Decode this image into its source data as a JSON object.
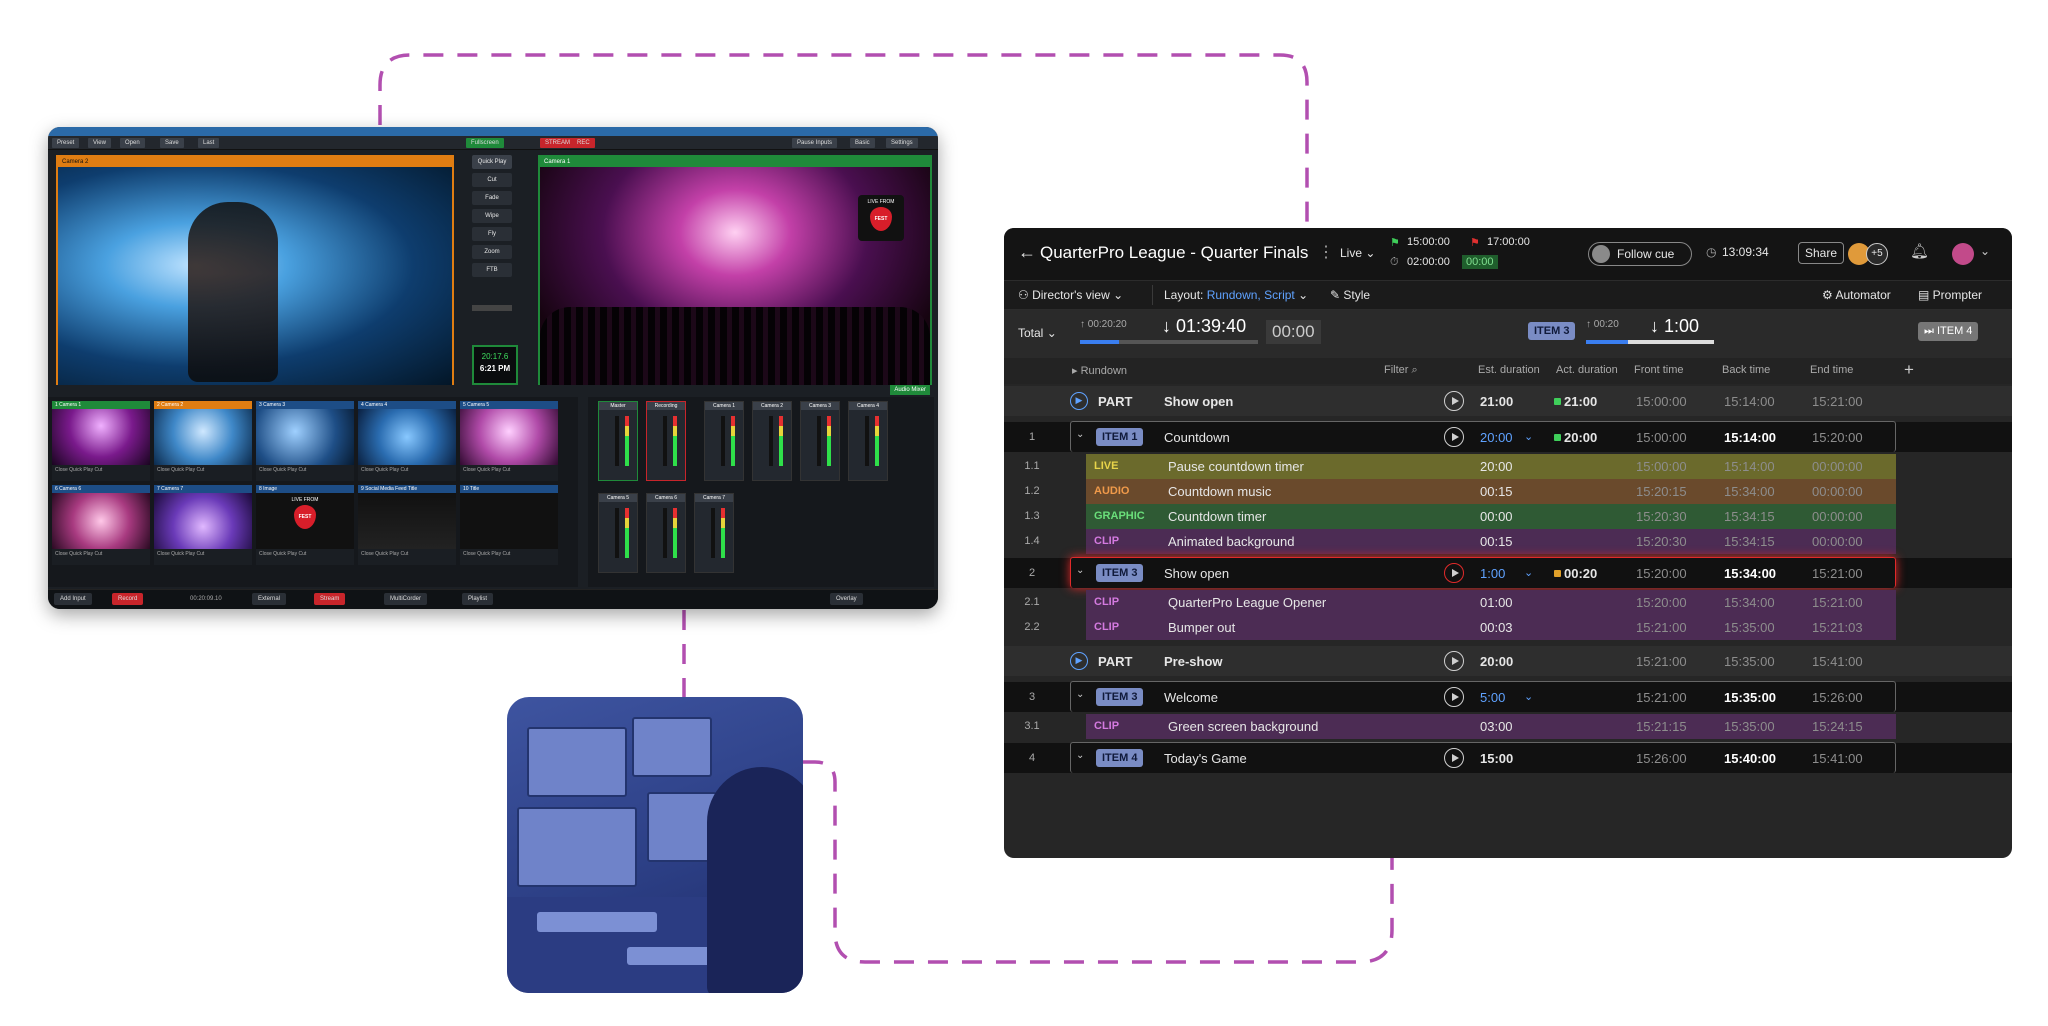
{
  "vmix": {
    "menu": [
      "Preset",
      "View",
      "Open",
      "Save",
      "Last"
    ],
    "fullscreen": "Fullscreen",
    "stream": "STREAM",
    "rec": "REC",
    "right_menu": [
      "Pause Inputs",
      "Basic",
      "Settings"
    ],
    "preview_label": "Camera 2",
    "program_label": "Camera 1",
    "badge_top": "LIVE FROM",
    "badge_pick": "FEST",
    "transitions": [
      "Quick Play",
      "Cut",
      "Fade",
      "Wipe",
      "Fly",
      "Zoom",
      "FTB"
    ],
    "clock_time": "20:17.6",
    "clock_pm": "6:21 PM",
    "inputs": [
      {
        "label": "1  Camera 1",
        "style": "g"
      },
      {
        "label": "2  Camera 2",
        "style": "o"
      },
      {
        "label": "3  Camera 3",
        "style": "b"
      },
      {
        "label": "4  Camera 4",
        "style": "b"
      },
      {
        "label": "5  Camera 5",
        "style": "b"
      },
      {
        "label": "6  Camera 6",
        "style": "b"
      },
      {
        "label": "7  Camera 7",
        "style": "b"
      },
      {
        "label": "8  Image",
        "style": "b"
      },
      {
        "label": "9  Social Media Feed Title",
        "style": "b"
      },
      {
        "label": "10  Title",
        "style": "b"
      }
    ],
    "input_controls": "Close  Quick Play  Cut",
    "mixer": [
      "Master",
      "Recording",
      "Camera 1",
      "Camera 2",
      "Camera 3",
      "Camera 4",
      "Camera 5",
      "Camera 6",
      "Camera 7"
    ],
    "audio_mixer": "Audio Mixer",
    "bottom": [
      "Add Input",
      "Record",
      "External",
      "Stream",
      "MultiCorder",
      "Playlist",
      "Overlay"
    ],
    "record_time": "00:20:09.10"
  },
  "rundown": {
    "back": "←",
    "title": "QuarterPro League - Quarter Finals",
    "mode": "Live",
    "start_time": "15:00:00",
    "end_time": "17:00:00",
    "elapsed": "02:00:00",
    "elapsed_badge": "00:00",
    "follow_cue": "Follow cue",
    "clock": "13:09:34",
    "share": "Share",
    "plus_users": "+5",
    "view": "Director's view",
    "layout_label": "Layout:",
    "layout_value": "Rundown, Script",
    "style": "Style",
    "automator": "Automator",
    "prompter": "Prompter",
    "total": "Total",
    "total_small": "00:20:20",
    "total_big": "01:39:40",
    "total_over": "00:00",
    "cur_item": "ITEM 3",
    "cur_small": "00:20",
    "cur_big": "1:00",
    "next_item": "ITEM 4",
    "col_rundown": "Rundown",
    "col_filter": "Filter",
    "cols": [
      "Est. duration",
      "Act. duration",
      "Front time",
      "Back time",
      "End time"
    ],
    "rows": [
      {
        "type": "part",
        "title": "Show open",
        "est": "21:00",
        "act": "21:00",
        "front": "15:00:00",
        "back": "15:14:00",
        "end": "15:21:00"
      },
      {
        "type": "item",
        "num": "1",
        "tag": "ITEM 1",
        "title": "Countdown",
        "est": "20:00",
        "act": "20:00",
        "front": "15:00:00",
        "back": "15:14:00",
        "end": "15:20:00"
      },
      {
        "type": "sub",
        "num": "1.1",
        "kind": "LIVE",
        "title": "Pause countdown timer",
        "est": "20:00",
        "front": "15:00:00",
        "back": "15:14:00",
        "end": "00:00:00"
      },
      {
        "type": "sub",
        "num": "1.2",
        "kind": "AUDIO",
        "title": "Countdown music",
        "est": "00:15",
        "front": "15:20:15",
        "back": "15:34:00",
        "end": "00:00:00"
      },
      {
        "type": "sub",
        "num": "1.3",
        "kind": "GRAPHIC",
        "title": "Countdown timer",
        "est": "00:00",
        "front": "15:20:30",
        "back": "15:34:15",
        "end": "00:00:00"
      },
      {
        "type": "sub",
        "num": "1.4",
        "kind": "CLIP",
        "title": "Animated background",
        "est": "00:15",
        "front": "15:20:30",
        "back": "15:34:15",
        "end": "00:00:00"
      },
      {
        "type": "item",
        "num": "2",
        "tag": "ITEM 3",
        "title": "Show open",
        "est": "1:00",
        "act": "00:20",
        "front": "15:20:00",
        "back": "15:34:00",
        "end": "15:21:00",
        "live": true
      },
      {
        "type": "sub",
        "num": "2.1",
        "kind": "CLIP",
        "title": "QuarterPro League Opener",
        "est": "01:00",
        "front": "15:20:00",
        "back": "15:34:00",
        "end": "15:21:00"
      },
      {
        "type": "sub",
        "num": "2.2",
        "kind": "CLIP",
        "title": "Bumper out",
        "est": "00:03",
        "front": "15:21:00",
        "back": "15:35:00",
        "end": "15:21:03"
      },
      {
        "type": "part",
        "title": "Pre-show",
        "est": "20:00",
        "act": "",
        "front": "15:21:00",
        "back": "15:35:00",
        "end": "15:41:00"
      },
      {
        "type": "item",
        "num": "3",
        "tag": "ITEM 3",
        "title": "Welcome",
        "est": "5:00",
        "act": "",
        "front": "15:21:00",
        "back": "15:35:00",
        "end": "15:26:00"
      },
      {
        "type": "sub",
        "num": "3.1",
        "kind": "CLIP",
        "title": "Green screen background",
        "est": "03:00",
        "front": "15:21:15",
        "back": "15:35:00",
        "end": "15:24:15"
      },
      {
        "type": "item",
        "num": "4",
        "tag": "ITEM 4",
        "title": "Today's Game",
        "est": "15:00",
        "act": "",
        "front": "15:26:00",
        "back": "15:40:00",
        "end": "15:41:00"
      }
    ],
    "part_label": "PART",
    "colors": {
      "live": "#6b6a2c",
      "audio": "#6a4a2c",
      "graphic": "#2f5a34",
      "clip": "#4c2c54",
      "tag": "#7a8cc4",
      "accent_blue": "#5fa2ff",
      "live_red": "#e02a2a"
    }
  }
}
